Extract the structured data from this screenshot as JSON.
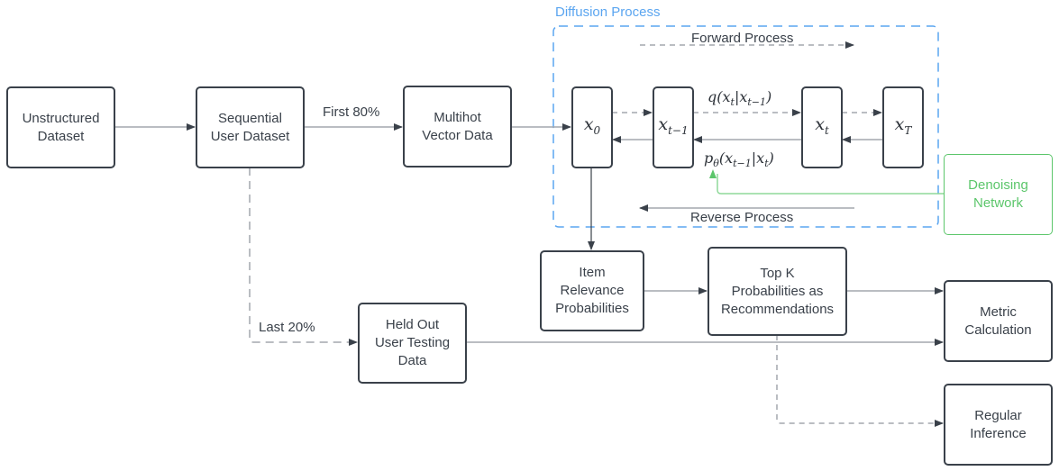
{
  "diagram": {
    "group": {
      "title": "Diffusion Process",
      "color": "#5aa5f0"
    },
    "nodes": {
      "unstructured": "Unstructured\nDataset",
      "sequential": "Sequential\nUser Dataset",
      "multihot": "Multihot\nVector Data",
      "item_relevance": "Item\nRelevance\nProbabilities",
      "top_k": "Top K\nProbabilities as\nRecommendations",
      "held_out": "Held Out\nUser Testing\nData",
      "metric": "Metric\nCalculation",
      "regular": "Regular\nInference",
      "denoising": "Denoising\nNetwork"
    },
    "states": {
      "x0": {
        "base": "x",
        "sub": "0"
      },
      "xt_minus_1": {
        "base": "x",
        "sub": "t−1"
      },
      "xt": {
        "base": "x",
        "sub": "t"
      },
      "xT": {
        "base": "x",
        "sub": "T"
      }
    },
    "edge_labels": {
      "first": "First 80%",
      "last": "Last 20%",
      "forward": "Forward Process",
      "reverse": "Reverse Process",
      "q_formula": {
        "pre": "q(x",
        "s1": "t",
        "mid": "|x",
        "s2": "t−1",
        "post": ")"
      },
      "p_formula": {
        "pre": "p",
        "s0": "θ",
        "a": "(x",
        "s1": "t−1",
        "mid": "|x",
        "s2": "t",
        "post": ")"
      }
    },
    "colors": {
      "line": "#3a414a",
      "green": "#5cc66b",
      "gray_line": "#a3a7ad"
    }
  }
}
